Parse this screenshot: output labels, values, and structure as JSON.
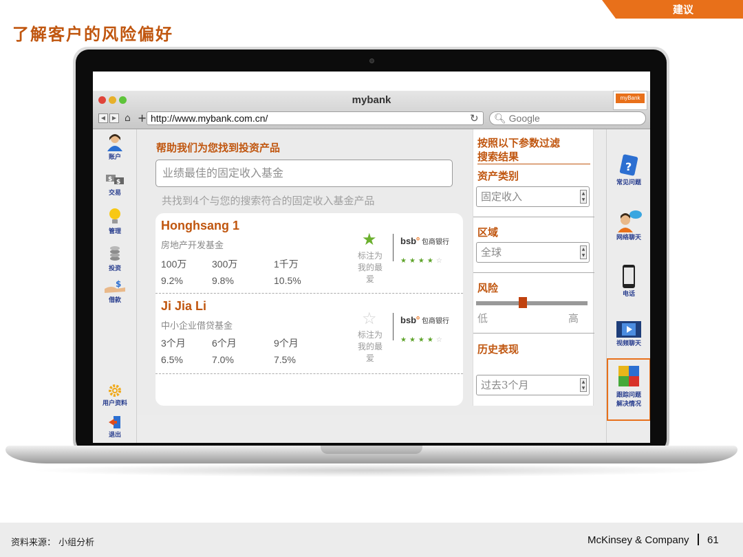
{
  "slide": {
    "tag": "建议",
    "title": "了解客户的风险偏好"
  },
  "browser": {
    "window_title": "mybank",
    "logo": "myBank",
    "url": "http://www.mybank.com.cn/",
    "search_placeholder": "Google"
  },
  "left_nav": [
    {
      "label": "账户",
      "icon": "account-icon"
    },
    {
      "label": "交易",
      "icon": "trade-icon"
    },
    {
      "label": "管理",
      "icon": "lightbulb-icon"
    },
    {
      "label": "投资",
      "icon": "coins-icon"
    },
    {
      "label": "借款",
      "icon": "loan-icon"
    },
    {
      "label": "用户资料",
      "icon": "gear-icon"
    },
    {
      "label": "退出",
      "icon": "exit-icon"
    }
  ],
  "right_nav": [
    {
      "label": "常见问题",
      "icon": "faq-icon"
    },
    {
      "label": "网络聊天",
      "icon": "chat-icon"
    },
    {
      "label": "电话",
      "icon": "phone-icon"
    },
    {
      "label": "视频聊天",
      "icon": "video-icon"
    },
    {
      "label": "跟踪问题解决情况",
      "label_line1": "跟踪问题",
      "label_line2": "解决情况",
      "icon": "puzzle-icon",
      "active": true
    }
  ],
  "main": {
    "helper_title": "帮助我们为您找到投资产品",
    "search_value": "业绩最佳的固定收入基金",
    "result_summary": "共找到4个与您的搜索符合的固定收入基金产品",
    "funds": [
      {
        "name": "Honghsang 1",
        "type": "房地产开发基金",
        "tiers": [
          "100万",
          "300万",
          "1千万"
        ],
        "returns": [
          "9.2%",
          "9.8%",
          "10.5%"
        ],
        "favorite": true,
        "fav_label": [
          "标注为",
          "我的最",
          "爱"
        ],
        "bank": "bsb",
        "bank_name": "包商银行",
        "rating": 4,
        "rating_max": 5
      },
      {
        "name": "Ji Jia Li",
        "type": "中小企业借贷基金",
        "tiers": [
          "3个月",
          "6个月",
          "9个月"
        ],
        "returns": [
          "6.5%",
          "7.0%",
          "7.5%"
        ],
        "favorite": false,
        "fav_label": [
          "标注为",
          "我的最",
          "爱"
        ],
        "bank": "bsb",
        "bank_name": "包商银行",
        "rating": 4,
        "rating_max": 5
      }
    ]
  },
  "filter": {
    "title_line1": "按照以下参数过滤",
    "title_line2": "搜索结果",
    "asset_label": "资产类别",
    "asset_value": "固定收入",
    "region_label": "区域",
    "region_value": "全球",
    "risk_label": "风险",
    "risk_low": "低",
    "risk_high": "高",
    "risk_level": 0.42,
    "history_label": "历史表现",
    "history_value": "过去3个月"
  },
  "footer": {
    "source": "资料来源： 小组分析",
    "brand": "McKinsey & Company",
    "page": "61"
  },
  "colors": {
    "accent": "#e8701a",
    "title": "#c0560f",
    "nav_text": "#2a3f8f"
  }
}
